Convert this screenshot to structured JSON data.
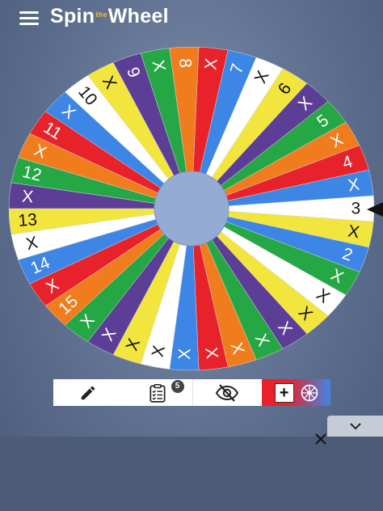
{
  "app": {
    "title_left": "Spin",
    "title_small": "the",
    "title_right": "Wheel"
  },
  "wheel": {
    "colors": [
      "#ffffff",
      "#f2e53e",
      "#3d86e6",
      "#26a745",
      "#e8222b",
      "#f07c1e",
      "#5d3e96"
    ],
    "slices": [
      {
        "label": "3",
        "color": "#ffffff"
      },
      {
        "label": "X",
        "color": "#f2e53e"
      },
      {
        "label": "2",
        "color": "#3d86e6"
      },
      {
        "label": "X",
        "color": "#26a745"
      },
      {
        "label": "X",
        "color": "#ffffff"
      },
      {
        "label": "X",
        "color": "#f2e53e"
      },
      {
        "label": "X",
        "color": "#5d3e96"
      },
      {
        "label": "X",
        "color": "#26a745"
      },
      {
        "label": "X",
        "color": "#f07c1e"
      },
      {
        "label": "X",
        "color": "#e8222b"
      },
      {
        "label": "X",
        "color": "#3d86e6"
      },
      {
        "label": "X",
        "color": "#ffffff"
      },
      {
        "label": "X",
        "color": "#f2e53e"
      },
      {
        "label": "X",
        "color": "#5d3e96"
      },
      {
        "label": "X",
        "color": "#26a745"
      },
      {
        "label": "15",
        "color": "#f07c1e"
      },
      {
        "label": "X",
        "color": "#e8222b"
      },
      {
        "label": "14",
        "color": "#3d86e6"
      },
      {
        "label": "X",
        "color": "#ffffff"
      },
      {
        "label": "13",
        "color": "#f2e53e"
      },
      {
        "label": "X",
        "color": "#5d3e96"
      },
      {
        "label": "12",
        "color": "#26a745"
      },
      {
        "label": "X",
        "color": "#f07c1e"
      },
      {
        "label": "11",
        "color": "#e8222b"
      },
      {
        "label": "X",
        "color": "#3d86e6"
      },
      {
        "label": "10",
        "color": "#ffffff"
      },
      {
        "label": "X",
        "color": "#f2e53e"
      },
      {
        "label": "9",
        "color": "#5d3e96"
      },
      {
        "label": "X",
        "color": "#26a745"
      },
      {
        "label": "8",
        "color": "#f07c1e"
      },
      {
        "label": "X",
        "color": "#e8222b"
      },
      {
        "label": "7",
        "color": "#3d86e6"
      },
      {
        "label": "X",
        "color": "#ffffff"
      },
      {
        "label": "6",
        "color": "#f2e53e"
      },
      {
        "label": "X",
        "color": "#5d3e96"
      },
      {
        "label": "5",
        "color": "#26a745"
      },
      {
        "label": "X",
        "color": "#f07c1e"
      },
      {
        "label": "4",
        "color": "#e8222b"
      },
      {
        "label": "X",
        "color": "#3d86e6"
      }
    ]
  },
  "toolbar": {
    "edit_icon": "pencil-icon",
    "list_icon": "clipboard-checklist-icon",
    "list_badge": "5",
    "hide_icon": "eye-slash-icon",
    "add_label": "+",
    "wheel_icon": "mini-wheel-icon"
  },
  "panel": {
    "collapse_icon": "chevron-down-icon",
    "close_icon": "close-icon"
  }
}
